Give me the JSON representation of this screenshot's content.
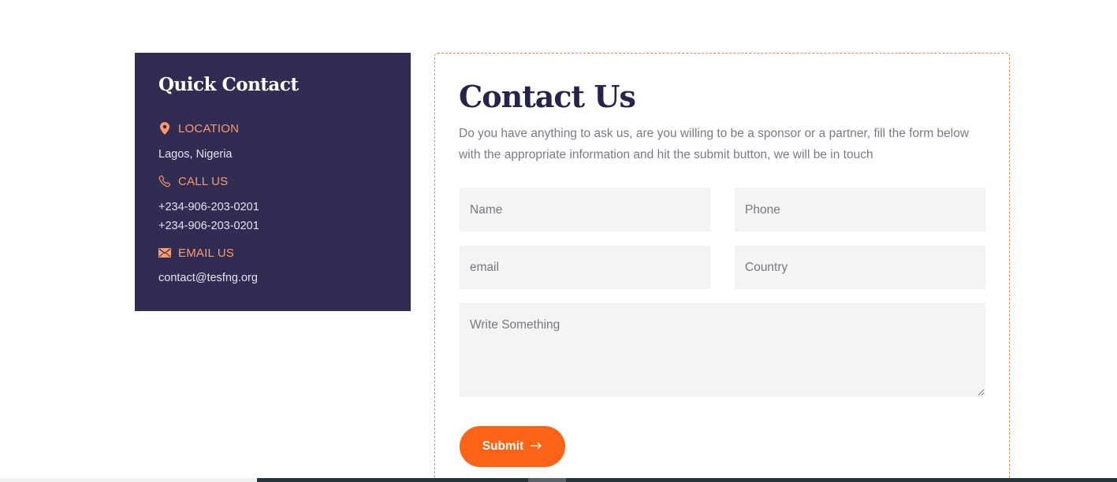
{
  "quick_contact": {
    "title": "Quick Contact",
    "location": {
      "icon": "map-pin-icon",
      "label": "LOCATION",
      "value": "Lagos, Nigeria"
    },
    "call": {
      "icon": "phone-icon",
      "label": "CALL US",
      "values": [
        "+234-906-203-0201",
        "+234-906-203-0201"
      ]
    },
    "email": {
      "icon": "envelope-icon",
      "label": "EMAIL US",
      "value": "contact@tesfng.org"
    }
  },
  "contact_form": {
    "title": "Contact Us",
    "description": "Do you have anything to ask us, are you willing to be a sponsor or a partner, fill the form below with the appropriate information and hit the submit button, we will be in touch",
    "fields": {
      "name": {
        "placeholder": "Name",
        "value": ""
      },
      "phone": {
        "placeholder": "Phone",
        "value": ""
      },
      "email": {
        "placeholder": "email",
        "value": ""
      },
      "country": {
        "placeholder": "Country",
        "value": ""
      },
      "message": {
        "placeholder": "Write Something",
        "value": ""
      }
    },
    "submit_label": "Submit",
    "submit_icon": "arrow-right-icon"
  },
  "colors": {
    "panel_bg": "#312c52",
    "accent": "#fd6316",
    "label_accent": "#ff9a6b",
    "title_dark": "#26244a"
  }
}
